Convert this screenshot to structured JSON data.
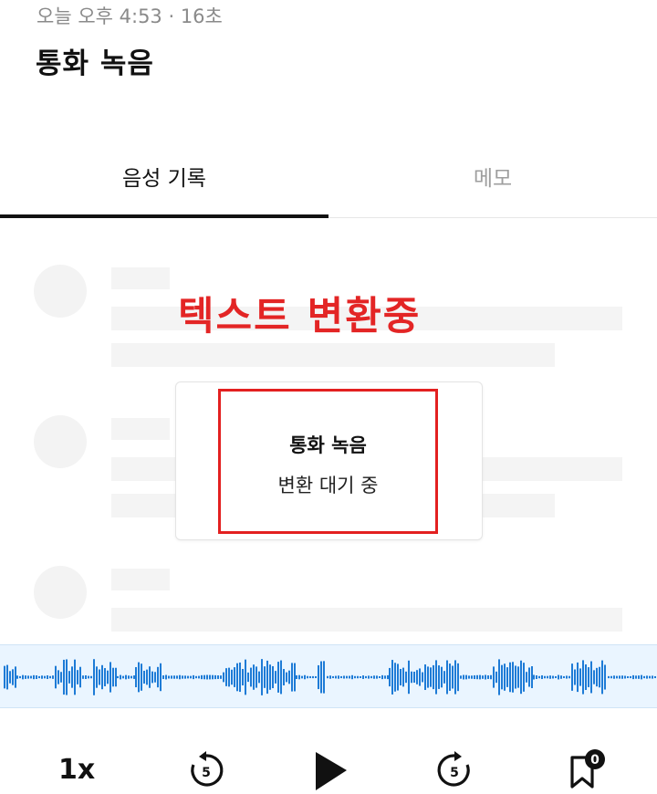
{
  "header": {
    "meta": "오늘 오후 4:53 · 16초",
    "title": "통화 녹음"
  },
  "tabs": [
    {
      "label": "음성 기록",
      "active": true
    },
    {
      "label": "메모",
      "active": false
    }
  ],
  "annotation": {
    "label": "텍스트 변환중",
    "color": "#e32525"
  },
  "status_card": {
    "title": "통화 녹음",
    "status": "변환 대기 중"
  },
  "waveform": {
    "color": "#1e7bd6",
    "background": "#eaf5ff"
  },
  "player": {
    "speed_label": "1x",
    "rewind_seconds": "5",
    "forward_seconds": "5",
    "bookmark_count": "0",
    "icons": [
      "rewind-5-icon",
      "play-icon",
      "forward-5-icon",
      "bookmark-icon"
    ]
  }
}
